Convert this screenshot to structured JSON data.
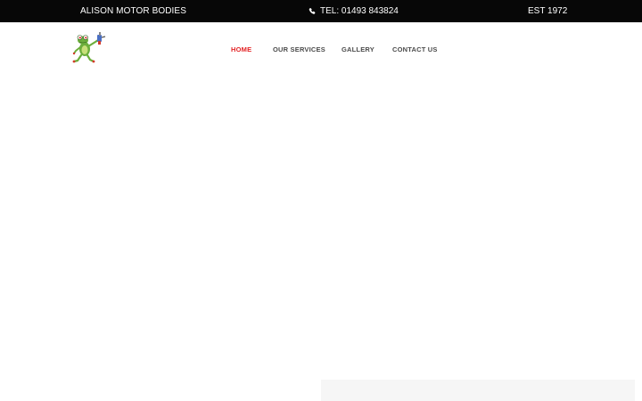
{
  "topbar": {
    "company": "ALISON MOTOR BODIES",
    "phone_icon": "phone-icon",
    "phone": "TEL: 01493 843824",
    "established": "EST 1972"
  },
  "logo": {
    "icon": "frog-mascot-logo"
  },
  "nav": {
    "items": [
      {
        "label": "HOME",
        "active": true
      },
      {
        "label": "OUR SERVICES",
        "active": false
      },
      {
        "label": "GALLERY",
        "active": false
      },
      {
        "label": "CONTACT US",
        "active": false
      }
    ]
  },
  "colors": {
    "topbar_bg": "#070707",
    "nav_active": "#e32224",
    "nav_text": "#4b4b4b",
    "panel_bg": "#f6f6f6"
  }
}
